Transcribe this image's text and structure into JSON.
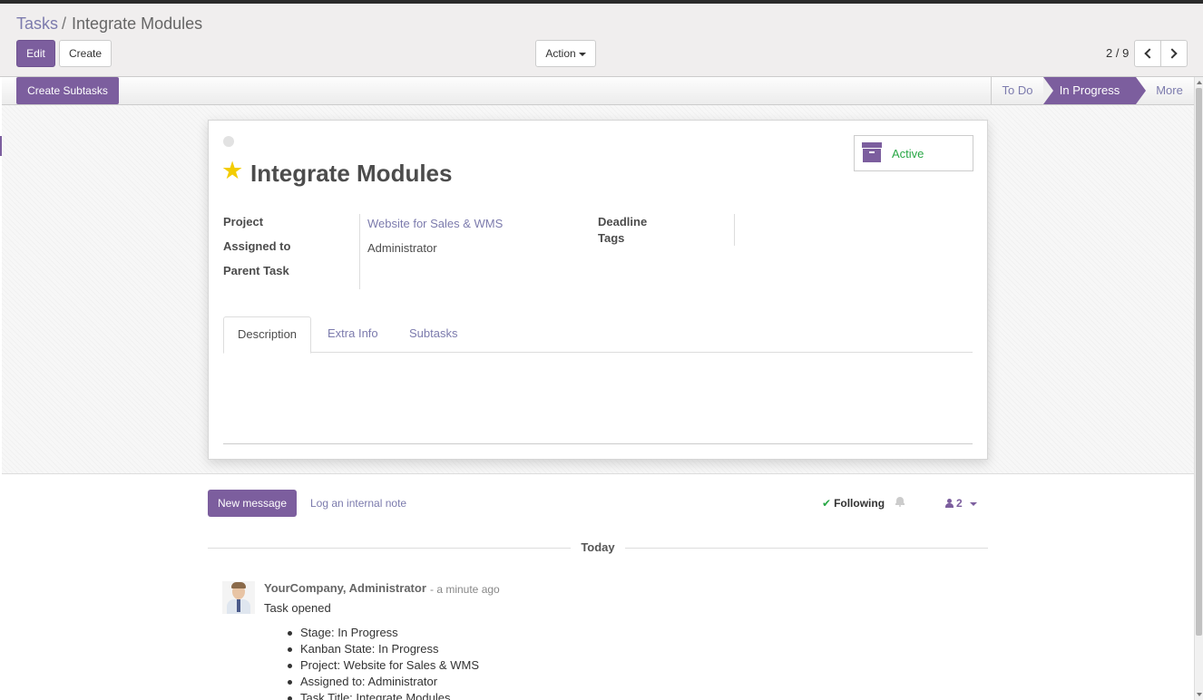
{
  "breadcrumb": {
    "parent": "Tasks",
    "separator": "/",
    "current": "Integrate Modules"
  },
  "toolbar": {
    "edit_label": "Edit",
    "create_label": "Create",
    "action_label": "Action"
  },
  "pager": {
    "text": "2 / 9",
    "current": 2,
    "total": 9
  },
  "header": {
    "create_subtasks_label": "Create Subtasks",
    "stages": [
      {
        "label": "To Do",
        "active": false
      },
      {
        "label": "In Progress",
        "active": true
      },
      {
        "label": "More",
        "active": false
      }
    ]
  },
  "task": {
    "title": "Integrate Modules",
    "starred": true,
    "active_label": "Active",
    "fields": {
      "project_label": "Project",
      "project_value": "Website for Sales & WMS",
      "assigned_label": "Assigned to",
      "assigned_value": "Administrator",
      "parent_label": "Parent Task",
      "parent_value": "",
      "deadline_label": "Deadline",
      "deadline_value": "",
      "tags_label": "Tags",
      "tags_value": ""
    },
    "tabs": [
      {
        "label": "Description",
        "active": true
      },
      {
        "label": "Extra Info",
        "active": false
      },
      {
        "label": "Subtasks",
        "active": false
      }
    ]
  },
  "chatter": {
    "new_message_label": "New message",
    "log_note_label": "Log an internal note",
    "following_label": "Following",
    "followers_count": "2",
    "date_separator": "Today",
    "message": {
      "author": "YourCompany, Administrator",
      "time": "- a minute ago",
      "body": "Task opened",
      "changes": [
        "Stage: In Progress",
        "Kanban State: In Progress",
        "Project: Website for Sales & WMS",
        "Assigned to: Administrator",
        "Task Title: Integrate Modules"
      ]
    }
  },
  "colors": {
    "brand": "#7c5e9e",
    "link": "#7c7bad",
    "star": "#f3cc00",
    "success": "#28a745"
  },
  "icons": [
    "chevron-left-icon",
    "chevron-right-icon",
    "star-icon",
    "archive-icon",
    "check-icon",
    "bell-icon",
    "user-icon",
    "caret-down-icon"
  ]
}
